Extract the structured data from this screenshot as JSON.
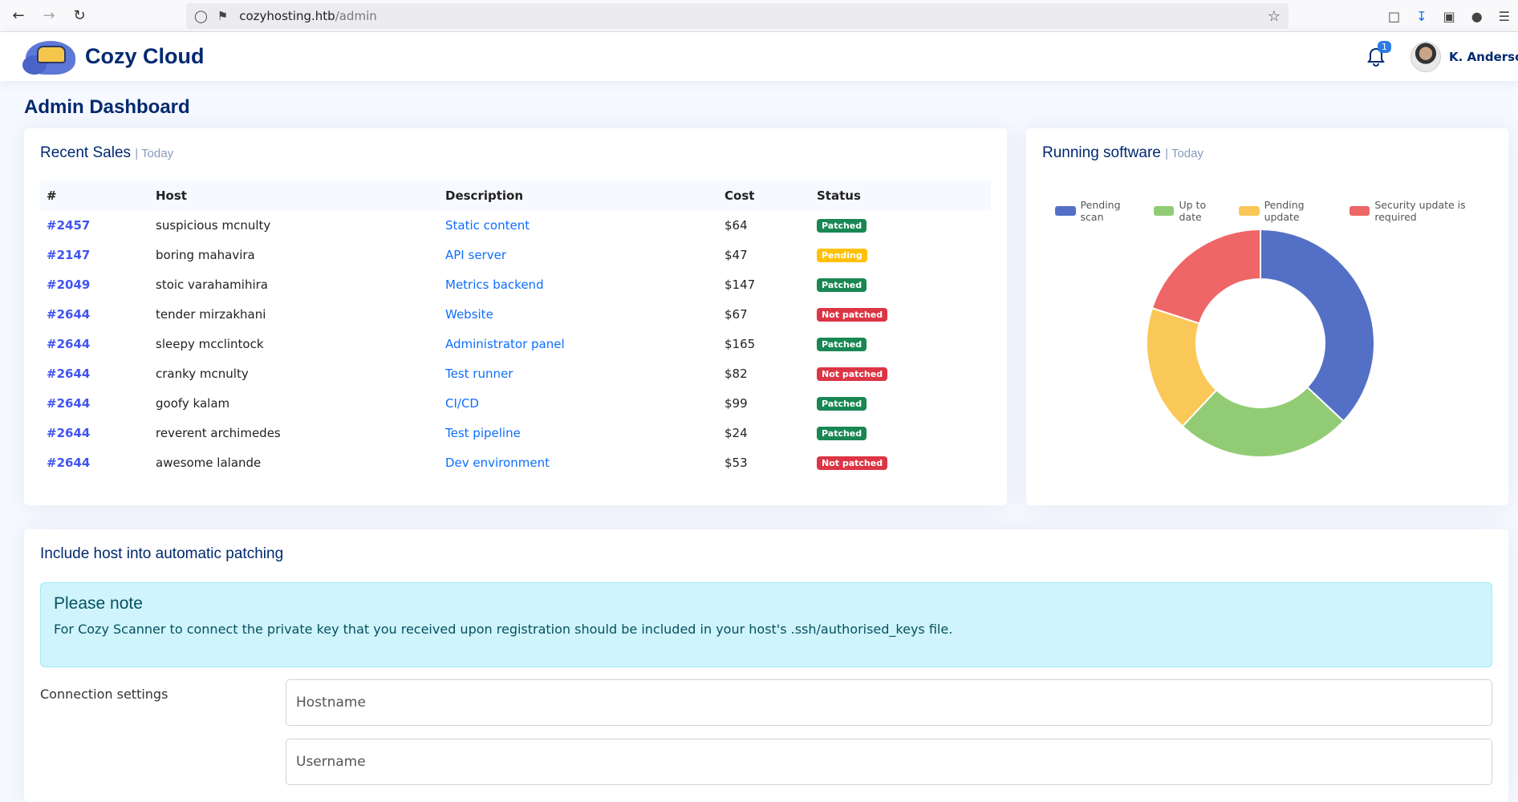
{
  "browser": {
    "url_host": "cozyhosting.htb",
    "url_path": "/admin"
  },
  "header": {
    "brand": "Cozy Cloud",
    "notification_count": "1",
    "user_name": "K. Anderson"
  },
  "page": {
    "title": "Admin Dashboard"
  },
  "recent_sales": {
    "title": "Recent Sales",
    "subtitle": "| Today",
    "columns": [
      "#",
      "Host",
      "Description",
      "Cost",
      "Status"
    ],
    "rows": [
      {
        "id": "#2457",
        "host": "suspicious mcnulty",
        "desc": "Static content",
        "cost": "$64",
        "status": "Patched"
      },
      {
        "id": "#2147",
        "host": "boring mahavira",
        "desc": "API server",
        "cost": "$47",
        "status": "Pending"
      },
      {
        "id": "#2049",
        "host": "stoic varahamihira",
        "desc": "Metrics backend",
        "cost": "$147",
        "status": "Patched"
      },
      {
        "id": "#2644",
        "host": "tender mirzakhani",
        "desc": "Website",
        "cost": "$67",
        "status": "Not patched"
      },
      {
        "id": "#2644",
        "host": "sleepy mcclintock",
        "desc": "Administrator panel",
        "cost": "$165",
        "status": "Patched"
      },
      {
        "id": "#2644",
        "host": "cranky mcnulty",
        "desc": "Test runner",
        "cost": "$82",
        "status": "Not patched"
      },
      {
        "id": "#2644",
        "host": "goofy kalam",
        "desc": "CI/CD",
        "cost": "$99",
        "status": "Patched"
      },
      {
        "id": "#2644",
        "host": "reverent archimedes",
        "desc": "Test pipeline",
        "cost": "$24",
        "status": "Patched"
      },
      {
        "id": "#2644",
        "host": "awesome lalande",
        "desc": "Dev environment",
        "cost": "$53",
        "status": "Not patched"
      }
    ]
  },
  "running_software": {
    "title": "Running software",
    "subtitle": "| Today"
  },
  "chart_data": {
    "type": "pie",
    "categories": [
      "Pending scan",
      "Up to date",
      "Pending update",
      "Security update is required"
    ],
    "values": [
      37,
      25,
      18,
      20
    ],
    "colors": [
      "#5470c6",
      "#91cc75",
      "#fac858",
      "#ee6666"
    ],
    "legend_position": "top"
  },
  "patching": {
    "title": "Include host into automatic patching",
    "note_heading": "Please note",
    "note_body": "For Cozy Scanner to connect the private key that you received upon registration should be included in your host's .ssh/authorised_keys file.",
    "connection_label": "Connection settings",
    "hostname_placeholder": "Hostname",
    "username_placeholder": "Username"
  }
}
